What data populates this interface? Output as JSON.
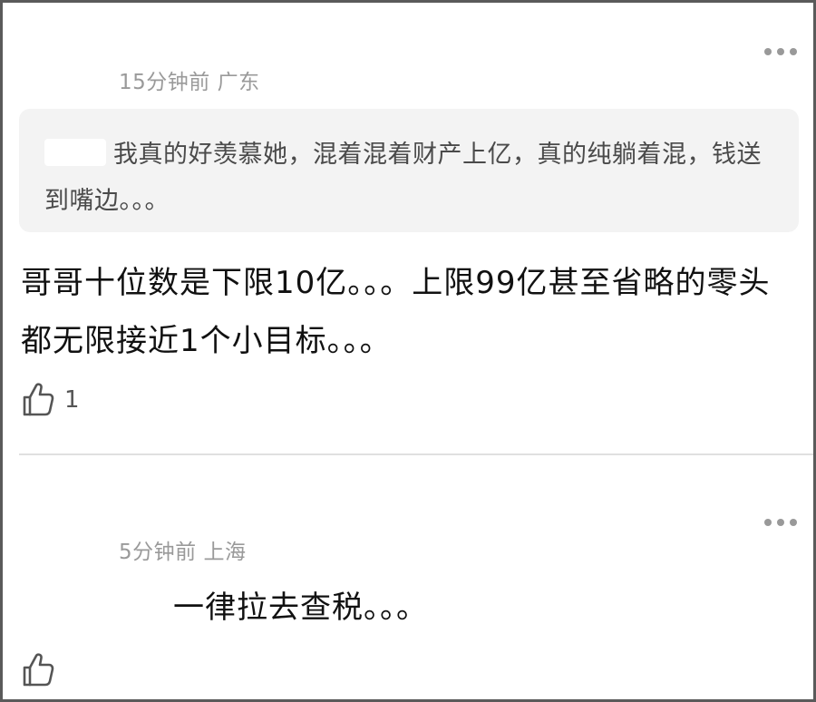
{
  "comments": [
    {
      "meta": "15分钟前 广东",
      "quote": "我真的好羡慕她，混着混着财产上亿，真的纯躺着混，钱送到嘴边。。。",
      "text": "哥哥十位数是下限10亿。。。上限99亿甚至省略的零头都无限接近1个小目标。。。",
      "likes": "1"
    },
    {
      "meta": "5分钟前 上海",
      "text": "一律拉去查税。。。"
    }
  ],
  "icons": {
    "more": "more-horizontal-icon",
    "like": "thumbs-up-icon"
  },
  "colors": {
    "meta_text": "#9a9a9a",
    "quote_bg": "#f3f3f3",
    "body_text": "#111111"
  }
}
